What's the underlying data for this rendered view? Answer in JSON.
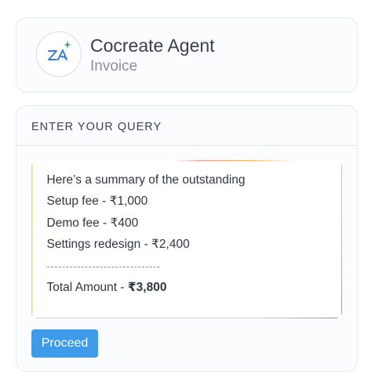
{
  "agent": {
    "name": "Cocreate Agent",
    "subtitle": "Invoice",
    "logo_icon": "zia-sparkle-logo-icon",
    "logo_text": "ZA"
  },
  "query": {
    "title": "ENTER YOUR QUERY",
    "lines": [
      "Here’s a summary of the outstanding",
      "Setup fee - ₹1,000",
      "Demo fee - ₹400",
      "Settings redesign - ₹2,400"
    ],
    "divider": "------------------------------",
    "total_label": "Total Amount - ",
    "total_value": "₹3,800"
  },
  "actions": {
    "proceed_label": "Proceed"
  },
  "colors": {
    "accent": "#3d9be9",
    "logo_green": "#49a96a",
    "logo_blue": "#3c7fd0"
  }
}
